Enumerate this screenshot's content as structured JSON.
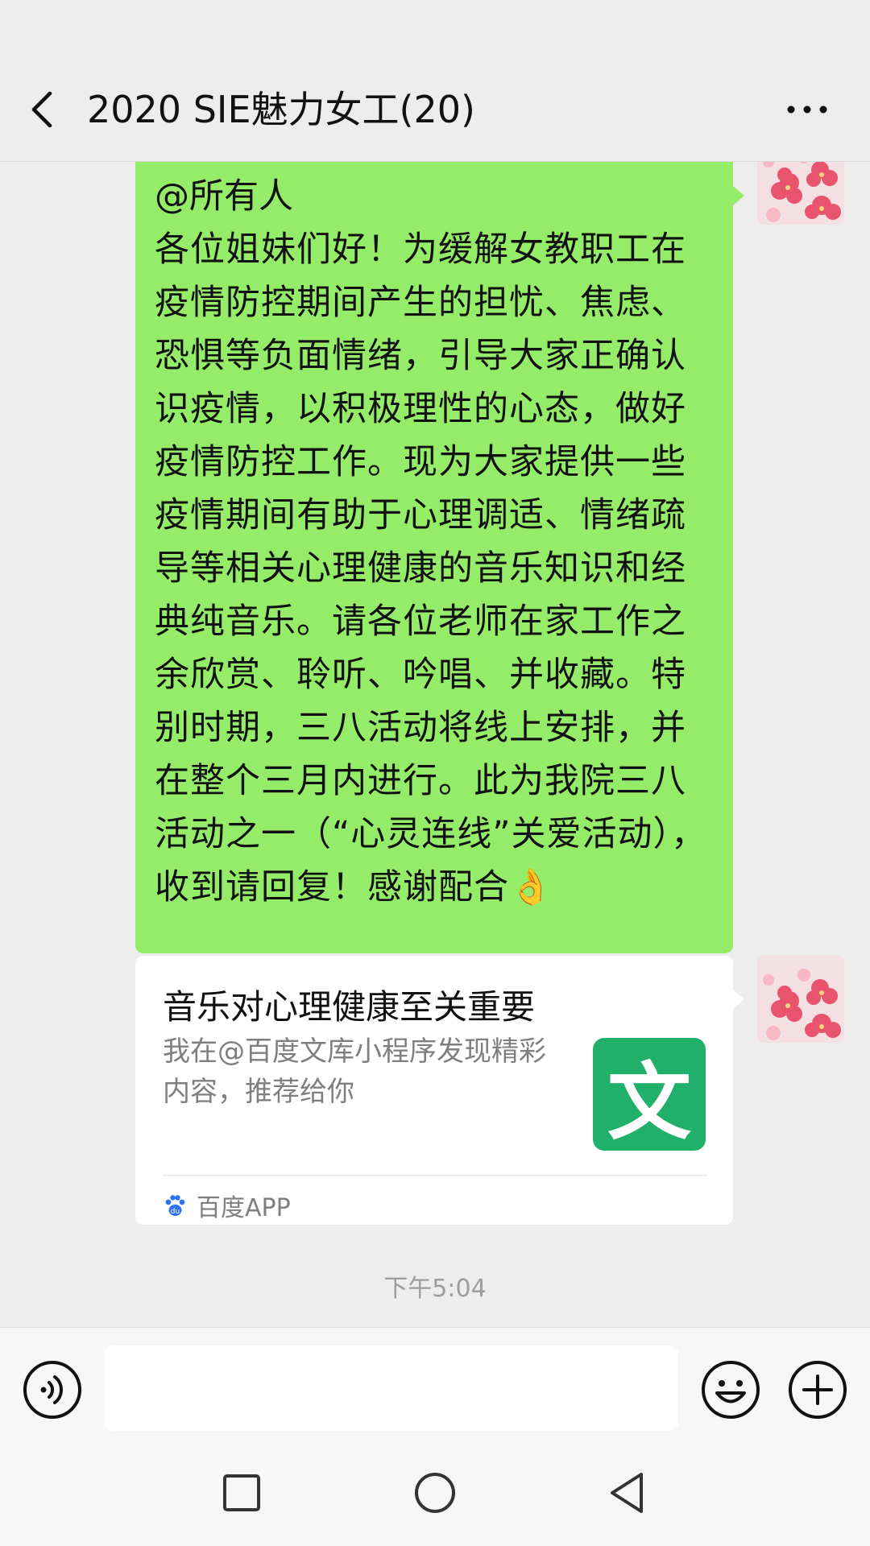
{
  "header": {
    "title": "2020 SIE魅力女工(20)"
  },
  "messages": {
    "text_message": {
      "mention": "@所有人",
      "body": "各位姐妹们好！为缓解女教职工在疫情防控期间产生的担忧、焦虑、恐惧等负面情绪，引导大家正确认识疫情，以积极理性的心态，做好疫情防控工作。现为大家提供一些疫情期间有助于心理调适、情绪疏导等相关心理健康的音乐知识和经典纯音乐。请各位老师在家工作之余欣赏、聆听、吟唱、并收藏。特别时期，三八活动将线上安排，并在整个三月内进行。此为我院三八活动之一（“心灵连线”关爱活动），收到请回复！感谢配合👌"
    },
    "link_card": {
      "title": "音乐对心理健康至关重要",
      "description": "我在@百度文库小程序发现精彩内容，推荐给你",
      "thumbnail_glyph": "文",
      "source": "百度APP"
    },
    "timestamp": "下午5:04"
  },
  "input": {
    "placeholder": ""
  },
  "colors": {
    "sent_bubble": "#95ec69",
    "card_background": "#ffffff",
    "thumbnail": "#21b06a",
    "chat_background": "#ededed"
  },
  "icons": {
    "back": "chevron-left-icon",
    "more": "more-dots-icon",
    "voice": "voice-icon",
    "emoji": "emoji-icon",
    "plus": "plus-icon",
    "source": "baidu-paw-icon",
    "nav": [
      "square-icon",
      "circle-icon",
      "triangle-back-icon"
    ]
  }
}
